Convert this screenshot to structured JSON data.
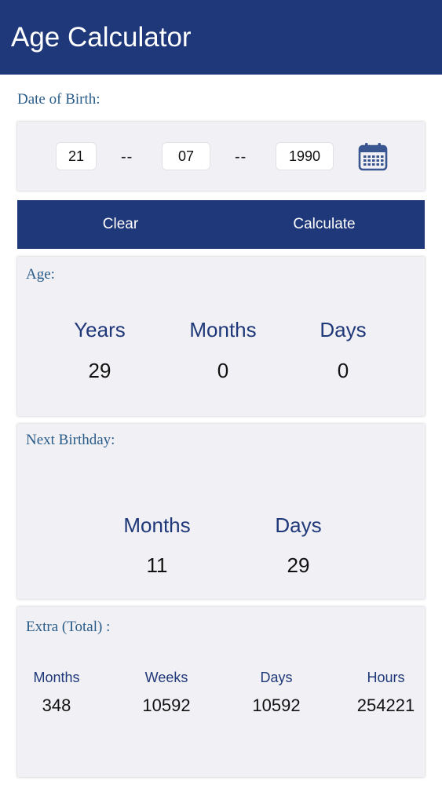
{
  "header": {
    "title": "Age Calculator"
  },
  "dob": {
    "label": "Date of Birth:",
    "day": "21",
    "month": "07",
    "year": "1990",
    "separator": "--"
  },
  "actions": {
    "clear_label": "Clear",
    "calculate_label": "Calculate"
  },
  "age": {
    "label": "Age:",
    "columns": [
      {
        "head": "Years",
        "value": "29"
      },
      {
        "head": "Months",
        "value": "0"
      },
      {
        "head": "Days",
        "value": "0"
      }
    ]
  },
  "next_birthday": {
    "label": "Next Birthday:",
    "columns": [
      {
        "head": "Months",
        "value": "11"
      },
      {
        "head": "Days",
        "value": "29"
      }
    ]
  },
  "extra": {
    "label": "Extra (Total) :",
    "columns": [
      {
        "head": "Months",
        "value": "348"
      },
      {
        "head": "Weeks",
        "value": "10592"
      },
      {
        "head": "Days",
        "value": "10592"
      },
      {
        "head": "Hours",
        "value": "254221"
      }
    ]
  },
  "colors": {
    "brand": "#1f3879",
    "label": "#2a5c8a",
    "card": "#f1f0f4"
  },
  "icons": {
    "calendar": "calendar-icon"
  }
}
